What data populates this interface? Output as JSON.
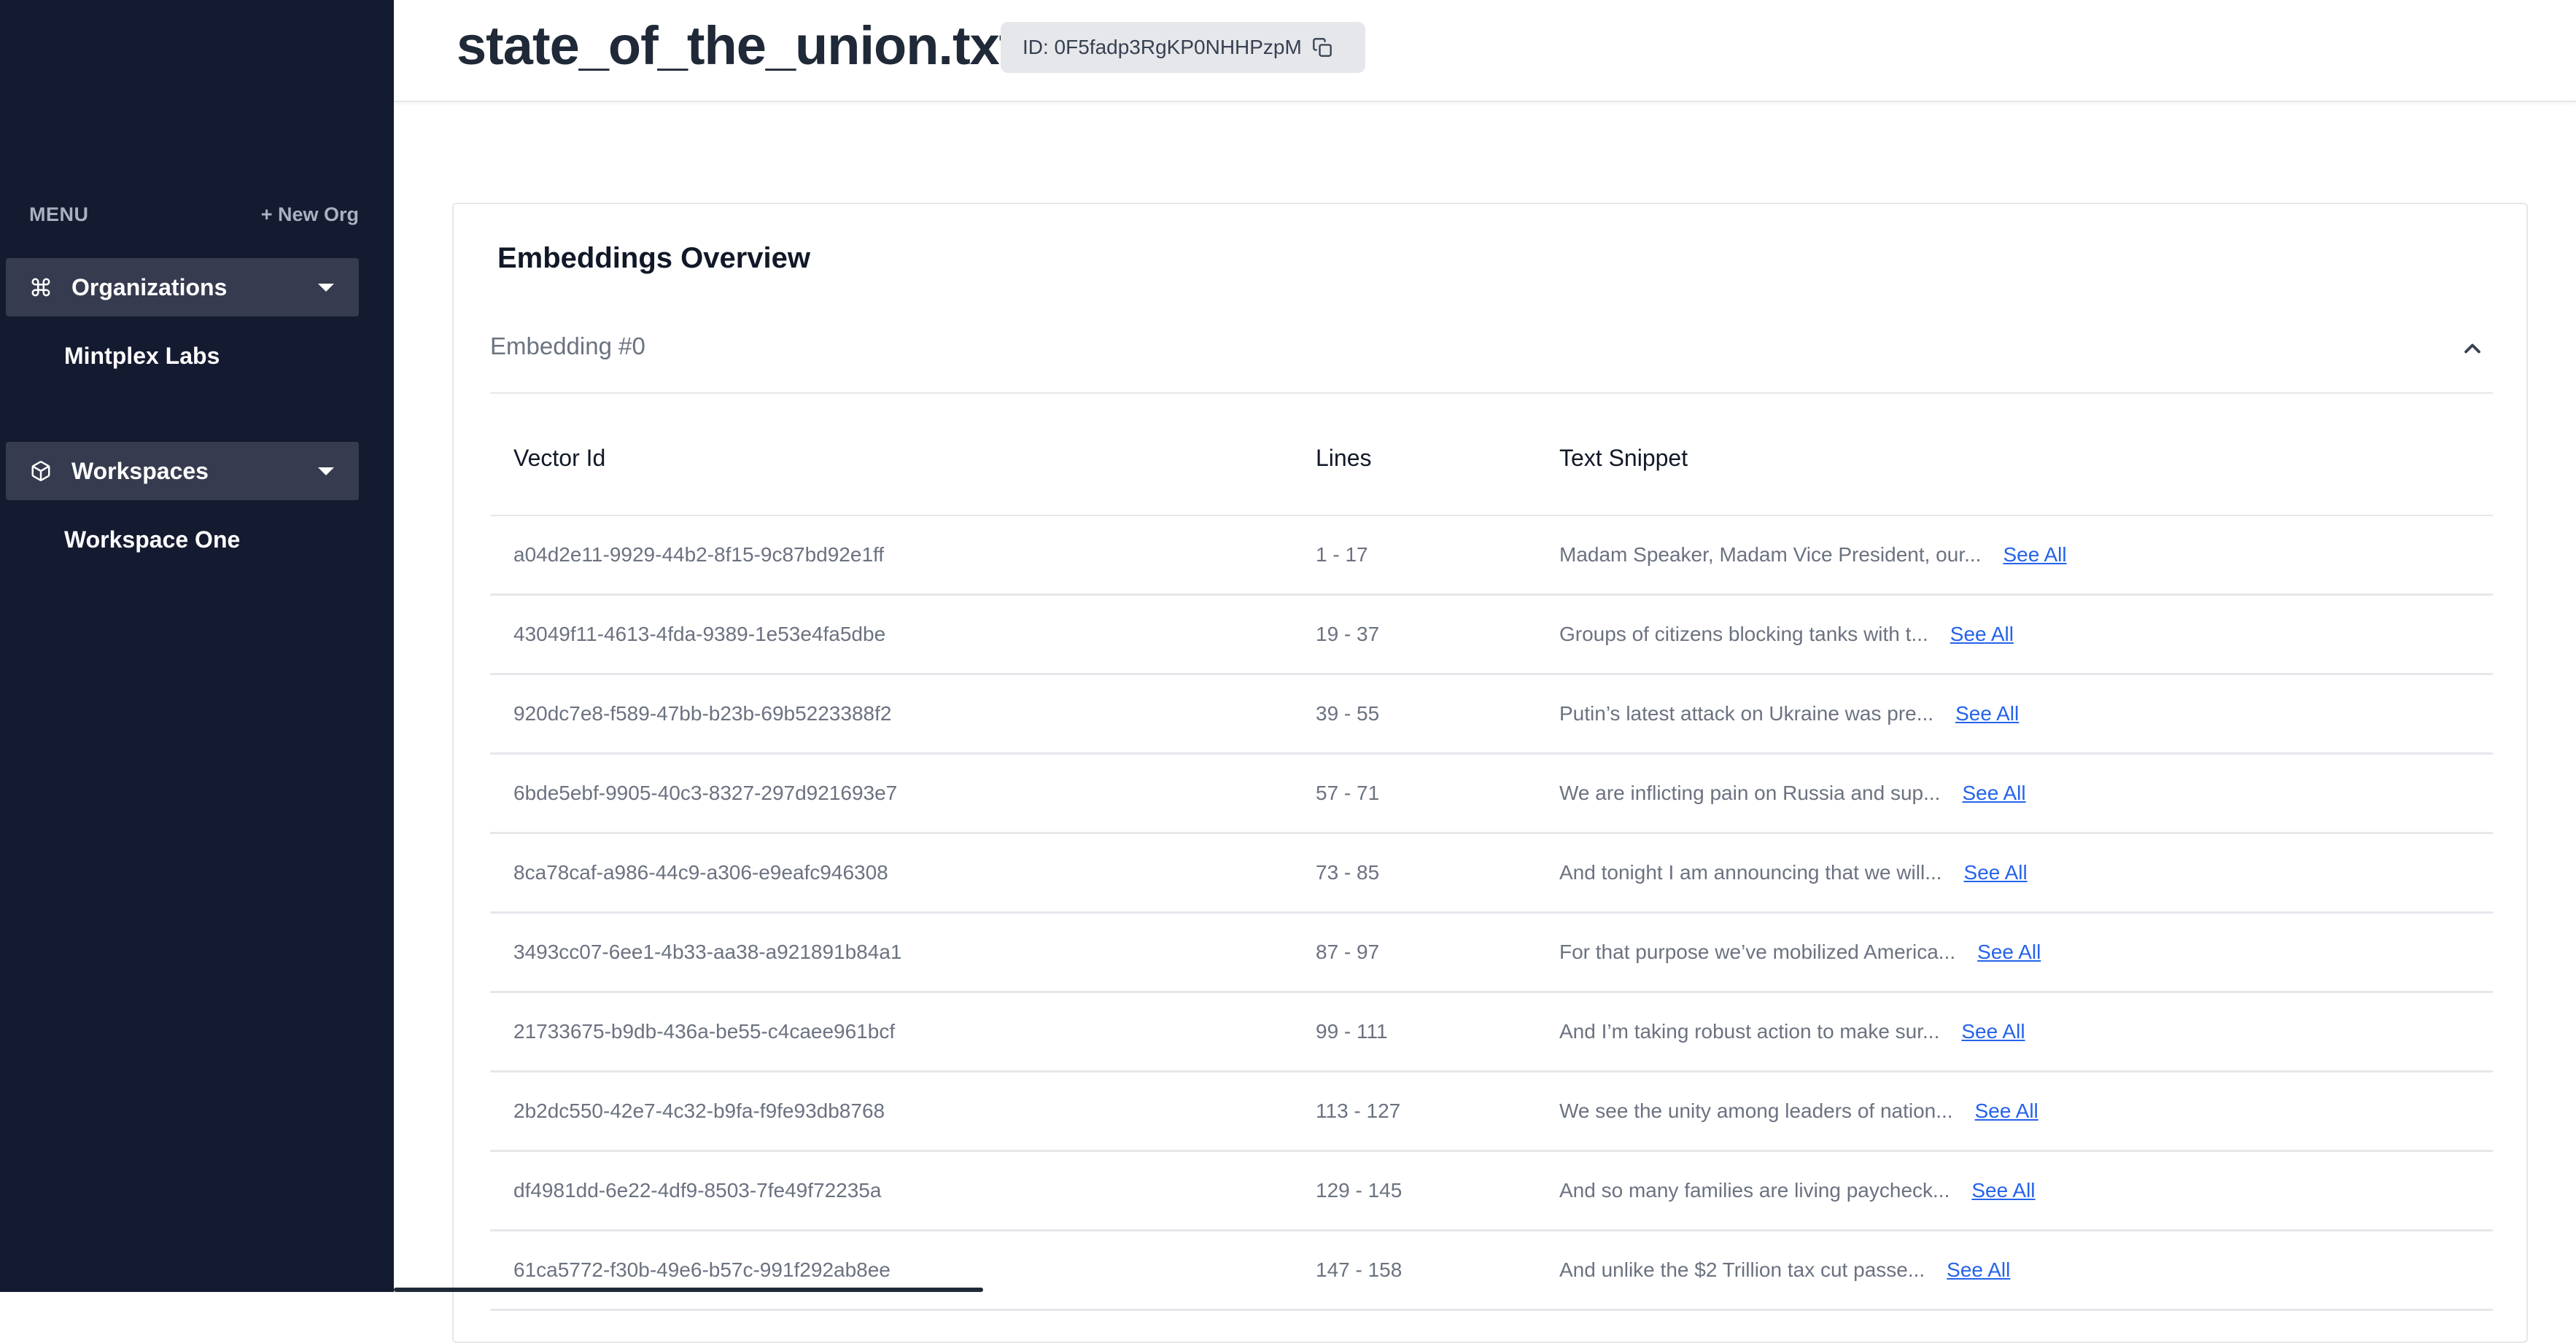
{
  "sidebar": {
    "menu_label": "MENU",
    "new_org_label": "+ New Org",
    "organizations": {
      "label": "Organizations",
      "items": [
        "Mintplex Labs"
      ]
    },
    "workspaces": {
      "label": "Workspaces",
      "items": [
        "Workspace One"
      ]
    }
  },
  "header": {
    "title": "state_of_the_union.txt",
    "id_badge": "ID: 0F5fadp3RgKP0NHHPzpM"
  },
  "main": {
    "card_title": "Embeddings Overview",
    "embedding_label": "Embedding #0",
    "table": {
      "columns": [
        "Vector Id",
        "Lines",
        "Text Snippet"
      ],
      "see_all_label": "See All",
      "rows": [
        {
          "vector_id": "a04d2e11-9929-44b2-8f15-9c87bd92e1ff",
          "lines": "1 - 17",
          "snippet": "Madam Speaker, Madam Vice President, our..."
        },
        {
          "vector_id": "43049f11-4613-4fda-9389-1e53e4fa5dbe",
          "lines": "19 - 37",
          "snippet": "Groups of citizens blocking tanks with t..."
        },
        {
          "vector_id": "920dc7e8-f589-47bb-b23b-69b5223388f2",
          "lines": "39 - 55",
          "snippet": "Putin’s latest attack on Ukraine was pre..."
        },
        {
          "vector_id": "6bde5ebf-9905-40c3-8327-297d921693e7",
          "lines": "57 - 71",
          "snippet": "We are inflicting pain on Russia and sup..."
        },
        {
          "vector_id": "8ca78caf-a986-44c9-a306-e9eafc946308",
          "lines": "73 - 85",
          "snippet": "And tonight I am announcing that we will..."
        },
        {
          "vector_id": "3493cc07-6ee1-4b33-aa38-a921891b84a1",
          "lines": "87 - 97",
          "snippet": "For that purpose we’ve mobilized America..."
        },
        {
          "vector_id": "21733675-b9db-436a-be55-c4caee961bcf",
          "lines": "99 - 111",
          "snippet": "And I’m taking robust action to make sur..."
        },
        {
          "vector_id": "2b2dc550-42e7-4c32-b9fa-f9fe93db8768",
          "lines": "113 - 127",
          "snippet": "We see the unity among leaders of nation..."
        },
        {
          "vector_id": "df4981dd-6e22-4df9-8503-7fe49f72235a",
          "lines": "129 - 145",
          "snippet": "And so many families are living paycheck..."
        },
        {
          "vector_id": "61ca5772-f30b-49e6-b57c-991f292ab8ee",
          "lines": "147 - 158",
          "snippet": "And unlike the $2 Trillion tax cut passe..."
        }
      ]
    }
  }
}
